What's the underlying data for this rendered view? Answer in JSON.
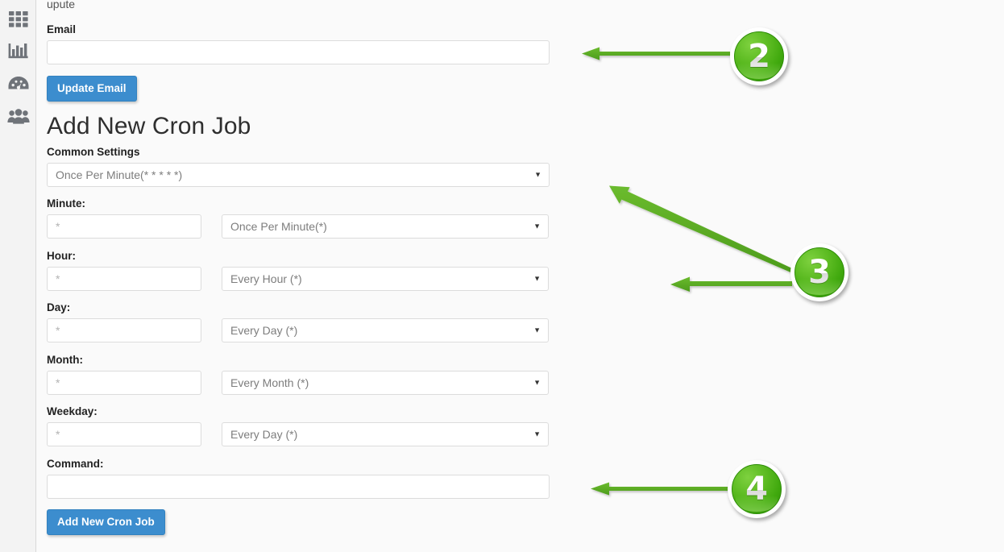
{
  "sidebar": {
    "items": [
      {
        "name": "apps-grid",
        "icon": "grid-icon"
      },
      {
        "name": "statistics",
        "icon": "bar-chart-icon"
      },
      {
        "name": "dashboard",
        "icon": "gauge-icon"
      },
      {
        "name": "users",
        "icon": "users-icon"
      }
    ]
  },
  "breadcrumb": "upute",
  "email_section": {
    "label": "Email",
    "value": "",
    "placeholder": "",
    "button": "Update Email"
  },
  "cron": {
    "heading": "Add New Cron Job",
    "common_settings_label": "Common Settings",
    "common_settings_value": "Once Per Minute(* * * * *)",
    "rows": [
      {
        "label": "Minute:",
        "value": "*",
        "preset": "Once Per Minute(*)"
      },
      {
        "label": "Hour:",
        "value": "*",
        "preset": "Every Hour (*)"
      },
      {
        "label": "Day:",
        "value": "*",
        "preset": "Every Day (*)"
      },
      {
        "label": "Month:",
        "value": "*",
        "preset": "Every Month (*)"
      },
      {
        "label": "Weekday:",
        "value": "*",
        "preset": "Every Day (*)"
      }
    ],
    "command_label": "Command:",
    "command_value": "",
    "submit": "Add New Cron Job"
  },
  "annotations": {
    "accent_color": "#5cb226",
    "markers": [
      {
        "number": "2",
        "points_to": "email-input"
      },
      {
        "number": "3",
        "points_to": "cron-schedule-fields"
      },
      {
        "number": "4",
        "points_to": "command-input"
      }
    ]
  },
  "colors": {
    "primary_button": "#3c8dce",
    "page_background": "#fafafa",
    "sidebar_background": "#f3f3f3",
    "annotation_green": "#5cb226"
  }
}
